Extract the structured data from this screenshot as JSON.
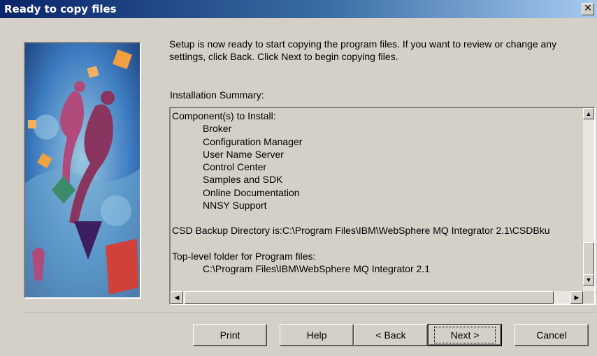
{
  "window": {
    "title": "Ready to copy files",
    "close_glyph": "✕"
  },
  "intro_text": "Setup is now ready to start copying the program files.  If you want to review or change any settings, click Back. Click Next to begin copying files.",
  "summary": {
    "label": "Installation Summary:",
    "components_header": "Component(s) to Install:",
    "components": [
      "Broker",
      "Configuration Manager",
      "User Name Server",
      "Control Center",
      "Samples and SDK",
      "Online Documentation",
      "NNSY Support"
    ],
    "csd_line": "CSD Backup Directory is:C:\\Program Files\\IBM\\WebSphere MQ Integrator 2.1\\CSDBku",
    "top_folder_label": "Top-level folder for Program files:",
    "top_folder_value": "C:\\Program Files\\IBM\\WebSphere MQ Integrator 2.1"
  },
  "buttons": {
    "print": "Print",
    "help": "Help",
    "back": "< Back",
    "next": "Next >",
    "cancel": "Cancel"
  },
  "icons": {
    "scroll_up": "▲",
    "scroll_down": "▼",
    "scroll_left": "◀",
    "scroll_right": "▶"
  }
}
